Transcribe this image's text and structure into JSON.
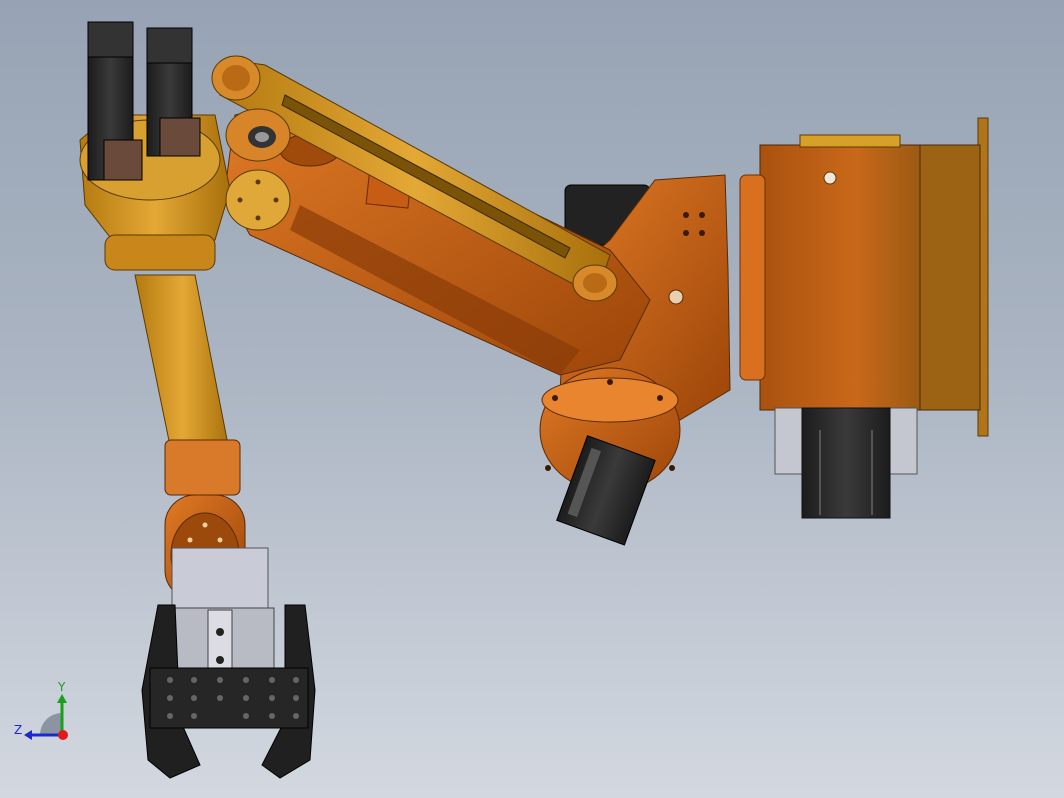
{
  "viewport": {
    "background_top": "#97a3b4",
    "background_bottom": "#d3d8e0"
  },
  "model": {
    "colors": {
      "orange": "#c9611a",
      "orange_dark": "#8a3a08",
      "gold": "#c68a1a",
      "gold_light": "#e0b040",
      "motor_black": "#2a2a2a",
      "plate_grey": "#c9cbd6"
    }
  },
  "triad": {
    "y_label": "Y",
    "z_label": "Z",
    "y_color": "#1aa01a",
    "z_color": "#1a2ad0",
    "x_color": "#e01a1a"
  }
}
